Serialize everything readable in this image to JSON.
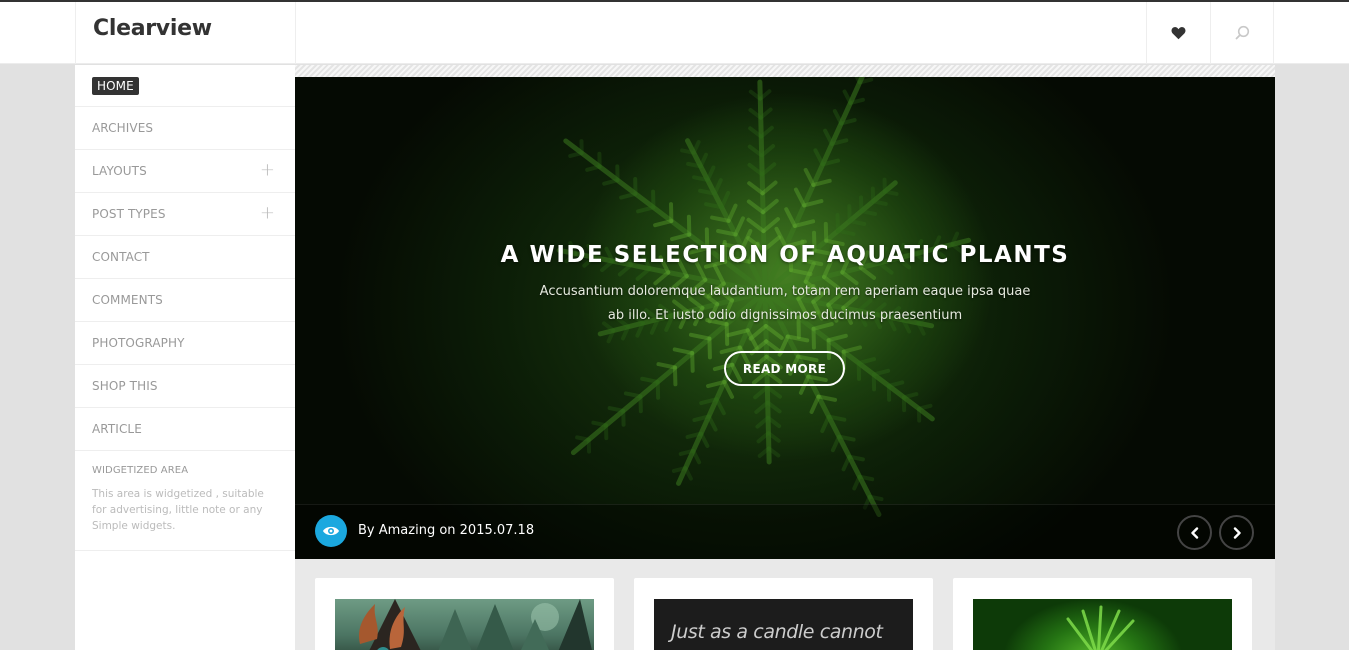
{
  "header": {
    "logo": "Clearview",
    "icons": [
      "heart-icon",
      "search-icon"
    ]
  },
  "sidebar": {
    "items": [
      {
        "label": "HOME",
        "active": true,
        "expandable": false
      },
      {
        "label": "ARCHIVES",
        "active": false,
        "expandable": false
      },
      {
        "label": "LAYOUTS",
        "active": false,
        "expandable": true
      },
      {
        "label": "POST TYPES",
        "active": false,
        "expandable": true
      },
      {
        "label": "CONTACT",
        "active": false,
        "expandable": false
      },
      {
        "label": "COMMENTS",
        "active": false,
        "expandable": false
      },
      {
        "label": "PHOTOGRAPHY",
        "active": false,
        "expandable": false
      },
      {
        "label": "SHOP THIS",
        "active": false,
        "expandable": false
      },
      {
        "label": "ARTICLE",
        "active": false,
        "expandable": false
      }
    ],
    "expand_glyph": "+",
    "widget": {
      "title": "WIDGETIZED AREA",
      "text": "This area is widgetized , suitable for advertising, little note or any Simple widgets."
    }
  },
  "hero": {
    "title": "A WIDE SELECTION OF AQUATIC PLANTS",
    "subtitle": "Accusantium doloremque laudantium, totam rem aperiam eaque ipsa quae ab illo. Et iusto odio dignissimos ducimus praesentium",
    "button_label": "READ MORE",
    "byline": "By Amazing on 2015.07.18",
    "prev_glyph": "‹",
    "next_glyph": "›",
    "accent_color": "#1ba8df"
  },
  "cards": [
    {
      "image": "fantasy-forest-creature",
      "text": ""
    },
    {
      "image": "quote",
      "text": "Just as a candle cannot"
    },
    {
      "image": "green-plant",
      "text": ""
    }
  ]
}
